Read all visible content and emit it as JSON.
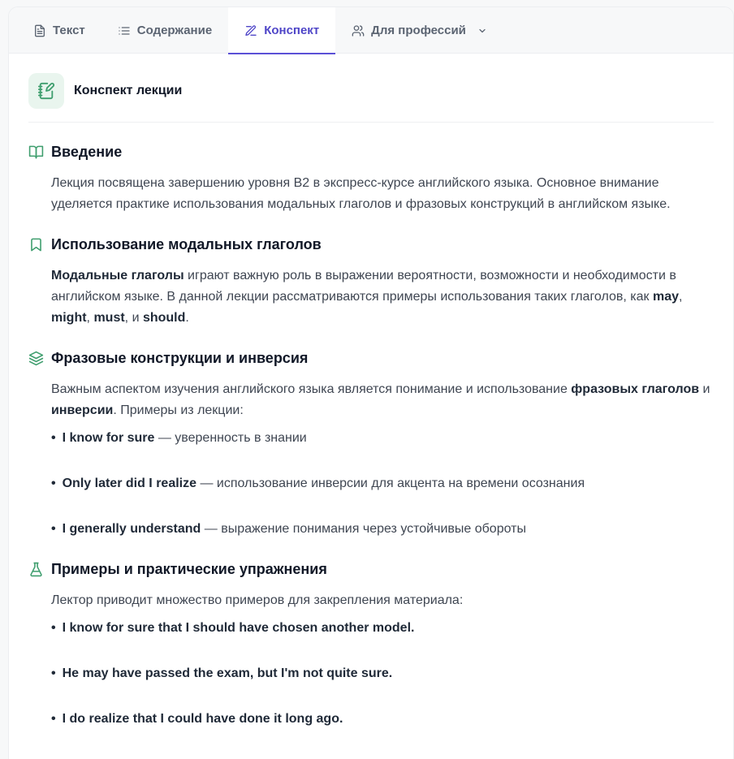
{
  "tabs": [
    {
      "label": "Текст",
      "icon": "document-icon"
    },
    {
      "label": "Содержание",
      "icon": "list-icon"
    },
    {
      "label": "Конспект",
      "icon": "edit-note-icon",
      "active": true
    },
    {
      "label": "Для профессий",
      "icon": "users-icon"
    }
  ],
  "header": {
    "title": "Конспект лекции",
    "icon": "notebook-pen-icon"
  },
  "accent_color": "#5b50d6",
  "green_color": "#3f9e6e",
  "sections": {
    "intro": {
      "title": "Введение",
      "icon": "book-open-icon",
      "text": "Лекция посвящена завершению уровня B2 в экспресс-курсе английского языка. Основное внимание уделяется практике использования модальных глаголов и фразовых конструкций в английском языке."
    },
    "modals": {
      "title": "Использование модальных глаголов",
      "icon": "bookmark-icon",
      "bold1": "Модальные глаголы",
      "text1": " играют важную роль в выражении вероятности, возможности и необходимости в английском языке. В данной лекции рассматриваются примеры использования таких глаголов, как ",
      "may": "may",
      "sep1": ", ",
      "might": "might",
      "sep2": ", ",
      "must": "must",
      "sep3": ", и ",
      "should": "should",
      "end": "."
    },
    "phrasal": {
      "title": "Фразовые конструкции и инверсия",
      "icon": "layers-icon",
      "text1": "Важным аспектом изучения английского языка является понимание и использование ",
      "bold1": "фразовых глаголов",
      "text2": " и ",
      "bold2": "инверсии",
      "text3": ". Примеры из лекции:",
      "items": [
        {
          "bold": "I know for sure",
          "rest": " — уверенность в знании"
        },
        {
          "bold": "Only later did I realize",
          "rest": " — использование инверсии для акцента на времени осознания"
        },
        {
          "bold": "I generally understand",
          "rest": " — выражение понимания через устойчивые обороты"
        }
      ]
    },
    "practice": {
      "title": "Примеры и практические упражнения",
      "icon": "flask-icon",
      "text": "Лектор приводит множество примеров для закрепления материала:",
      "items": [
        "I know for sure that I should have chosen another model.",
        "He may have passed the exam, but I'm not quite sure.",
        "I do realize that I could have done it long ago."
      ]
    }
  }
}
